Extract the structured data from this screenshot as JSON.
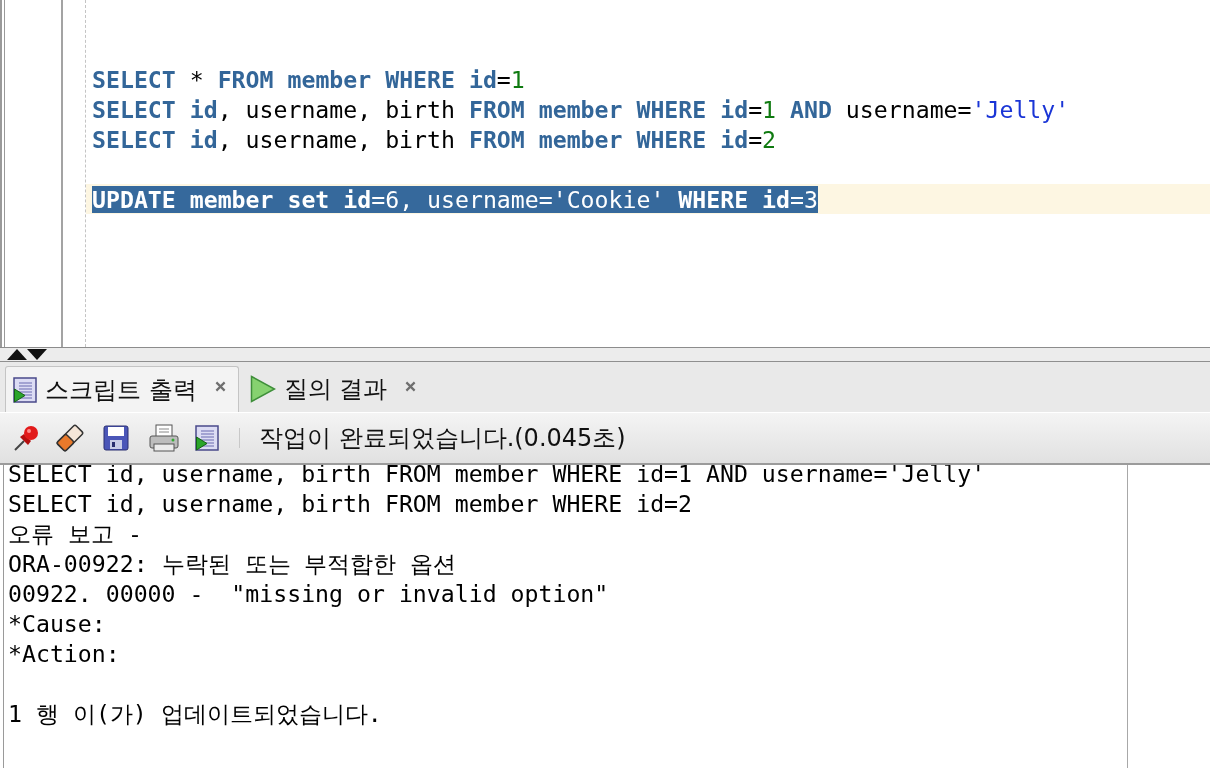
{
  "editor": {
    "blocks": [
      [
        {
          "selected": false,
          "current": false,
          "segments": [
            {
              "kind": "keyword",
              "text": "SELECT"
            },
            {
              "kind": "plain",
              "text": " * "
            },
            {
              "kind": "keyword",
              "text": "FROM member WHERE id"
            },
            {
              "kind": "plain",
              "text": "="
            },
            {
              "kind": "number",
              "text": "1"
            }
          ]
        },
        {
          "selected": false,
          "current": false,
          "segments": [
            {
              "kind": "keyword",
              "text": "SELECT id"
            },
            {
              "kind": "plain",
              "text": ", username, birth "
            },
            {
              "kind": "keyword",
              "text": "FROM member WHERE id"
            },
            {
              "kind": "plain",
              "text": "="
            },
            {
              "kind": "number",
              "text": "1"
            },
            {
              "kind": "keyword",
              "text": " AND"
            },
            {
              "kind": "plain",
              "text": " username="
            },
            {
              "kind": "string",
              "text": "'Jelly'"
            }
          ]
        },
        {
          "selected": false,
          "current": false,
          "segments": [
            {
              "kind": "keyword",
              "text": "SELECT id"
            },
            {
              "kind": "plain",
              "text": ", username, birth "
            },
            {
              "kind": "keyword",
              "text": "FROM member WHERE id"
            },
            {
              "kind": "plain",
              "text": "="
            },
            {
              "kind": "number",
              "text": "2"
            }
          ]
        }
      ],
      [
        {
          "selected": true,
          "current": true,
          "segments": [
            {
              "kind": "keyword",
              "text": "UPDATE member set id"
            },
            {
              "kind": "plain",
              "text": "="
            },
            {
              "kind": "number",
              "text": "6"
            },
            {
              "kind": "plain",
              "text": ", username="
            },
            {
              "kind": "string",
              "text": "'Cookie'"
            },
            {
              "kind": "keyword",
              "text": " WHERE id"
            },
            {
              "kind": "plain",
              "text": "="
            },
            {
              "kind": "number",
              "text": "3"
            }
          ]
        }
      ]
    ]
  },
  "output_panel": {
    "tabs": [
      {
        "kind": "script",
        "label": "스크립트 출력",
        "selected": true
      },
      {
        "kind": "query",
        "label": "질의 결과",
        "selected": false
      }
    ],
    "toolbar": {
      "status": "작업이 완료되었습니다.(0.045초)"
    },
    "output": {
      "blocks": [
        [
          "SELECT id, username, birth FROM member WHERE id=1 AND username='Jelly'",
          "SELECT id, username, birth FROM member WHERE id=2",
          "오류 보고 -",
          "ORA-00922: 누락된 또는 부적합한 옵션",
          "00922. 00000 -  \"missing or invalid option\"",
          "*Cause:",
          "*Action:"
        ],
        [
          "1 행 이(가) 업데이트되었습니다."
        ]
      ]
    }
  }
}
